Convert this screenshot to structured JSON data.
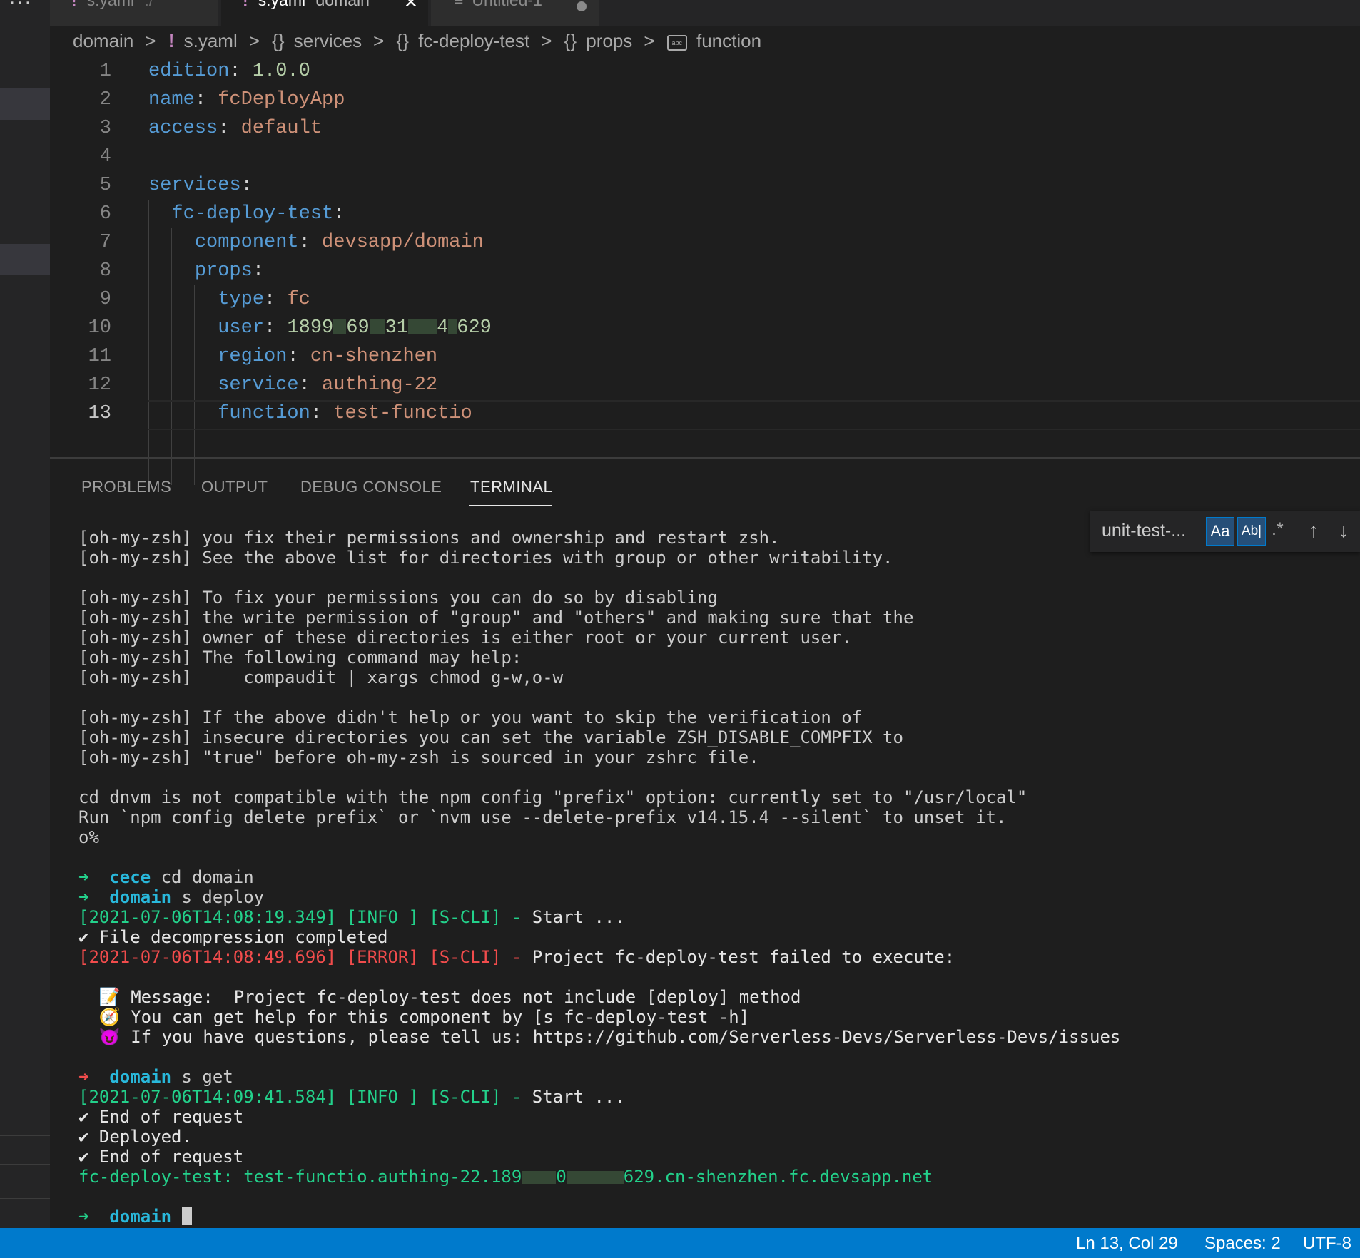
{
  "tabs": [
    {
      "name": "s.yaml",
      "hint": "./"
    },
    {
      "name": "s.yaml",
      "hint": "domain"
    },
    {
      "name": "Untitled-1"
    }
  ],
  "breadcrumb": [
    "domain",
    "s.yaml",
    "services",
    "fc-deploy-test",
    "props",
    "function"
  ],
  "editor": {
    "lines": [
      {
        "n": "1",
        "key": "edition",
        "value": "1.0.0",
        "value_type": "num"
      },
      {
        "n": "2",
        "key": "name",
        "value": "fcDeployApp",
        "value_type": "str"
      },
      {
        "n": "3",
        "key": "access",
        "value": "default",
        "value_type": "str"
      },
      {
        "n": "4"
      },
      {
        "n": "5",
        "key": "services",
        "value": ""
      },
      {
        "n": "6",
        "key": "fc-deploy-test",
        "value": ""
      },
      {
        "n": "7",
        "key": "component",
        "value": "devsapp/domain",
        "value_type": "str"
      },
      {
        "n": "8",
        "key": "props",
        "value": ""
      },
      {
        "n": "9",
        "key": "type",
        "value": "fc",
        "value_type": "str"
      },
      {
        "n": "10",
        "key": "user",
        "value_parts": [
          "1899",
          "69",
          "31",
          "4",
          "629"
        ],
        "value_type": "num"
      },
      {
        "n": "11",
        "key": "region",
        "value": "cn-shenzhen",
        "value_type": "str"
      },
      {
        "n": "12",
        "key": "service",
        "value": "authing-22",
        "value_type": "str"
      },
      {
        "n": "13",
        "key": "function",
        "value": "test-functio",
        "value_type": "str"
      }
    ]
  },
  "panel": {
    "tabs": [
      "PROBLEMS",
      "OUTPUT",
      "DEBUG CONSOLE",
      "TERMINAL"
    ],
    "active_tab": "TERMINAL"
  },
  "find": {
    "query": "unit-test-...",
    "match_case": "Aa",
    "whole_word": "Ab|",
    "regex": ".*"
  },
  "terminal": {
    "l1": "[oh-my-zsh] you fix their permissions and ownership and restart zsh.",
    "l2": "[oh-my-zsh] See the above list for directories with group or other writability.",
    "l3": "[oh-my-zsh] To fix your permissions you can do so by disabling",
    "l4": "[oh-my-zsh] the write permission of \"group\" and \"others\" and making sure that the",
    "l5": "[oh-my-zsh] owner of these directories is either root or your current user.",
    "l6": "[oh-my-zsh] The following command may help:",
    "l7": "[oh-my-zsh]     compaudit | xargs chmod g-w,o-w",
    "l8": "[oh-my-zsh] If the above didn't help or you want to skip the verification of",
    "l9": "[oh-my-zsh] insecure directories you can set the variable ZSH_DISABLE_COMPFIX to",
    "l10": "[oh-my-zsh] \"true\" before oh-my-zsh is sourced in your zshrc file.",
    "l11": "cd dnvm is not compatible with the npm config \"prefix\" option: currently set to \"/usr/local\"",
    "l12": "Run `npm config delete prefix` or `nvm use --delete-prefix v14.15.4 --silent` to unset it.",
    "l13": "o%",
    "p1_arrow": "➜",
    "p1_dir": "cece",
    "p1_cmd": "cd domain",
    "p2_arrow": "➜",
    "p2_dir": "domain",
    "p2_cmd": "s deploy",
    "info1": "[2021-07-06T14:08:19.349] [INFO ] [S-CLI] - ",
    "info1_msg": "Start ...",
    "ok1": "✔ File decompression completed",
    "err1": "[2021-07-06T14:08:49.696] [ERROR] [S-CLI] - ",
    "err1_msg": "Project fc-deploy-test failed to execute:",
    "msg1": "  📝 Message:  Project fc-deploy-test does not include [deploy] method",
    "msg2": "  🧭 You can get help for this component by [s fc-deploy-test -h]",
    "msg3": "  😈 If you have questions, please tell us: https://github.com/Serverless-Devs/Serverless-Devs/issues",
    "p3_arrow": "➜",
    "p3_dir": "domain",
    "p3_cmd": "s get",
    "info2": "[2021-07-06T14:09:41.584] [INFO ] [S-CLI] - ",
    "info2_msg": "Start ...",
    "ok2": "✔ End of request",
    "ok3": "✔ Deployed.",
    "ok4": "✔ End of request",
    "result_a": "fc-deploy-test: test-functio.authing-22.189",
    "result_b": "0",
    "result_c": "629.cn-shenzhen.fc.devsapp.net",
    "p4_arrow": "➜",
    "p4_dir": "domain"
  },
  "status": {
    "position": "Ln 13, Col 29",
    "spaces": "Spaces: 2",
    "encoding": "UTF-8"
  },
  "colors": {
    "background": "#1e1e1e",
    "statusbar": "#007acc",
    "yaml_key": "#569cd6",
    "yaml_string": "#ce9178",
    "yaml_number": "#b5cea8",
    "terminal_green": "#23d18b",
    "terminal_red": "#f14c4c",
    "terminal_cyan": "#29b8db"
  }
}
